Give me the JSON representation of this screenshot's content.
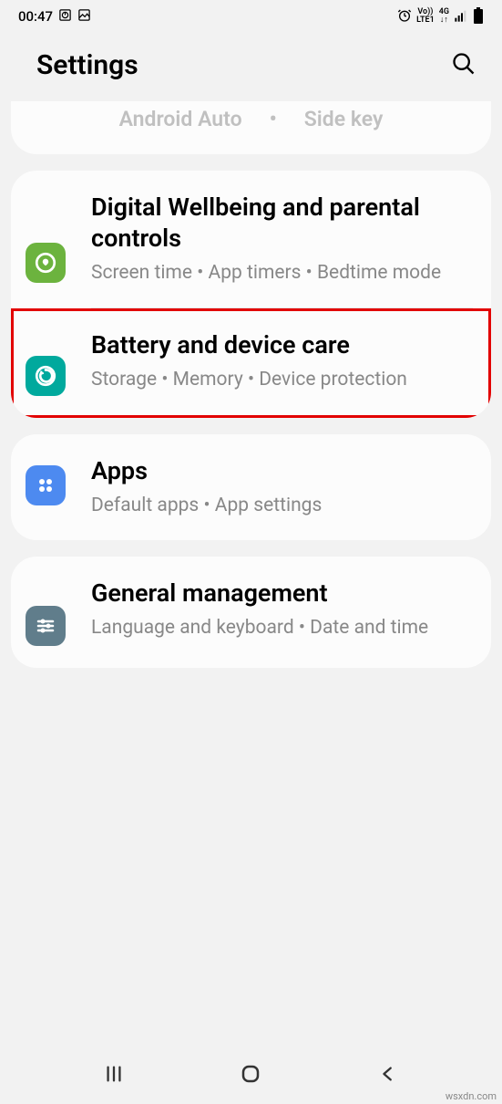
{
  "status": {
    "time": "00:47",
    "net1": "Vo))",
    "net2": "LTE1",
    "net3": "4G",
    "arrows": "↓↑"
  },
  "header": {
    "title": "Settings"
  },
  "partial": {
    "left": "Android Auto",
    "right": "Side key"
  },
  "items": {
    "wellbeing": {
      "title": "Digital Wellbeing and parental controls",
      "sub": "Screen time  •  App timers  •  Bedtime mode"
    },
    "device_care": {
      "title": "Battery and device care",
      "sub": "Storage  •  Memory  •  Device protection"
    },
    "apps": {
      "title": "Apps",
      "sub": "Default apps  •  App settings"
    },
    "general": {
      "title": "General management",
      "sub": "Language and keyboard  •  Date and time"
    }
  },
  "watermark": "wsxdn.com"
}
